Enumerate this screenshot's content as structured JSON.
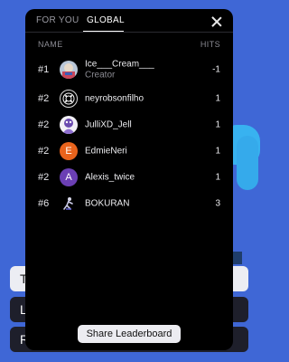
{
  "background": {
    "buttons": [
      "T",
      "L",
      "R"
    ]
  },
  "modal": {
    "tabs": [
      {
        "label": "FOR YOU",
        "active": false
      },
      {
        "label": "GLOBAL",
        "active": true
      }
    ],
    "columns": {
      "name": "NAME",
      "hits": "HITS"
    },
    "rows": [
      {
        "rank": "#1",
        "name": "Ice___Cream___",
        "subtitle": "Creator",
        "hits": "-1",
        "avatar": "photo-avatar"
      },
      {
        "rank": "#2",
        "name": "neyrobsonfilho",
        "hits": "1",
        "avatar": "pattern-avatar"
      },
      {
        "rank": "#2",
        "name": "JulliXD_Jell",
        "hits": "1",
        "avatar": "purple-avatar"
      },
      {
        "rank": "#2",
        "name": "EdmieNeri",
        "hits": "1",
        "avatar_letter": "E",
        "avatar_color": "#e8631c"
      },
      {
        "rank": "#2",
        "name": "Alexis_twice",
        "hits": "1",
        "avatar_letter": "A",
        "avatar_color": "#6b3fb4"
      },
      {
        "rank": "#6",
        "name": "BOKURAN",
        "hits": "3",
        "avatar": "figure-avatar"
      }
    ],
    "share_label": "Share Leaderboard"
  },
  "colors": {
    "page_background": "#3f67d6",
    "modal_background": "#000000",
    "share_button": "#ececf1"
  }
}
